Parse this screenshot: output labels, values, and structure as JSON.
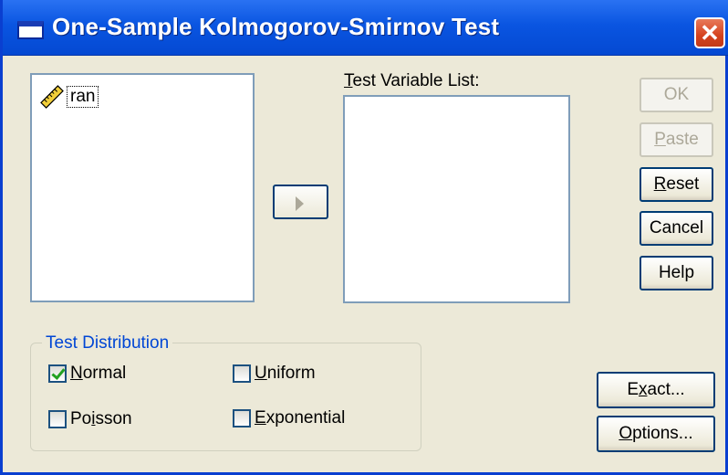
{
  "window": {
    "title": "One-Sample Kolmogorov-Smirnov Test",
    "close_label": "✕"
  },
  "source_list": {
    "items": [
      {
        "label": "ran",
        "icon": "scale-ruler-icon"
      }
    ]
  },
  "target_list": {
    "label_prefix": "",
    "label_mnemonic": "T",
    "label_rest": "est Variable List:"
  },
  "buttons": {
    "ok": {
      "label": "OK",
      "enabled": false
    },
    "paste": {
      "mnemonic": "P",
      "rest": "aste",
      "enabled": false
    },
    "reset": {
      "mnemonic": "R",
      "rest": "eset",
      "enabled": true
    },
    "cancel": {
      "label": "Cancel",
      "enabled": true
    },
    "help": {
      "label": "Help",
      "enabled": true
    },
    "exact": {
      "prefix": "E",
      "mnemonic": "x",
      "rest": "act...",
      "enabled": true
    },
    "options": {
      "mnemonic": "O",
      "rest": "ptions...",
      "enabled": true
    }
  },
  "test_distribution": {
    "title": "Test Distribution",
    "normal": {
      "mnemonic": "N",
      "rest": "ormal",
      "checked": true
    },
    "uniform": {
      "mnemonic": "U",
      "rest": "niform",
      "checked": false
    },
    "poisson": {
      "prefix": "Po",
      "mnemonic": "i",
      "rest": "sson",
      "checked": false
    },
    "exponential": {
      "mnemonic": "E",
      "rest": "xponential",
      "checked": false
    }
  },
  "colors": {
    "titlebar": "#0a55e1",
    "dialog_bg": "#ece9d8",
    "group_title": "#0046d5",
    "close_button": "#d5421e"
  }
}
